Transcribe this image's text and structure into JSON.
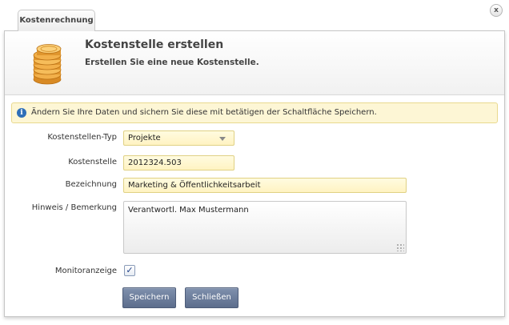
{
  "tab": {
    "label": "Kostenrechnung"
  },
  "close": {
    "glyph": "x"
  },
  "header": {
    "title": "Kostenstelle erstellen",
    "subtitle": "Erstellen Sie eine neue Kostenstelle.",
    "icon": "coins-stack-icon"
  },
  "info": {
    "icon": "info-icon",
    "text": "Ändern Sie Ihre Daten und sichern Sie diese mit betätigen der Schaltfläche Speichern."
  },
  "form": {
    "type_label": "Kostenstellen-Typ",
    "type_value": "Projekte",
    "cost_center_label": "Kostenstelle",
    "cost_center_value": "2012324.503",
    "name_label": "Bezeichnung",
    "name_value": "Marketing & Öffentlichkeitsarbeit",
    "note_label": "Hinweis / Bemerkung",
    "note_value": "Verantwortl. Max Mustermann",
    "monitor_label": "Monitoranzeige",
    "monitor_checked": true
  },
  "buttons": {
    "save": "Speichern",
    "close": "Schließen"
  },
  "colors": {
    "accent_button": "#6a7b99",
    "field_bg": "#fff5c8",
    "info_bg": "#fdf6d5",
    "info_icon": "#2f6fb8"
  }
}
